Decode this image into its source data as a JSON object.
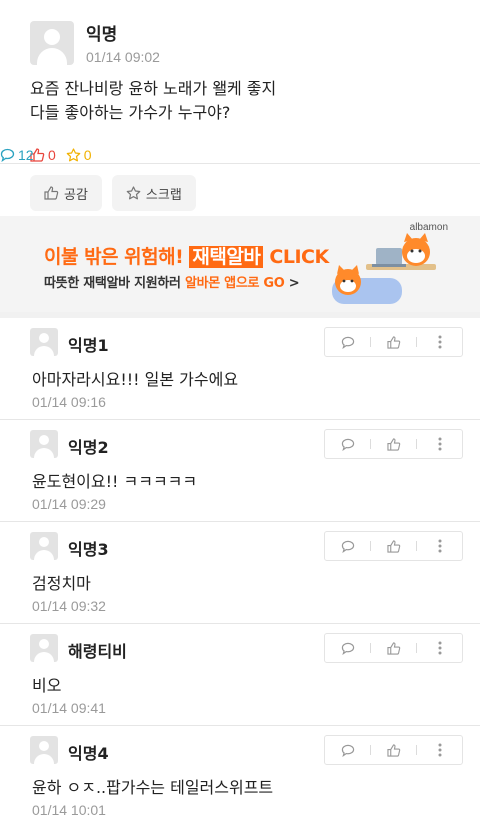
{
  "post": {
    "author": "익명",
    "time": "01/14 09:02",
    "body_line1": "요즘 잔나비랑 윤하 노래가 왤케 좋지",
    "body_line2": "다들 좋아하는 가수가 누구야?",
    "like_count": "0",
    "comment_count": "12",
    "scrap_count": "0",
    "like_button_label": "공감",
    "scrap_button_label": "스크랩"
  },
  "ad": {
    "brand": "albamon",
    "line1_a": "이불 밖은 위험해! ",
    "line1_b": "재택알바",
    "line1_c": " CLICK",
    "line2_a": "따뜻한 재택알바 지원하러 ",
    "line2_b": "알바몬 앱으로 GO",
    "line2_c": " >"
  },
  "comments": [
    {
      "author": "익명1",
      "text": "아마자라시요!!! 일본 가수에요",
      "time": "01/14 09:16"
    },
    {
      "author": "익명2",
      "text": "윤도현이요!! ㅋㅋㅋㅋㅋ",
      "time": "01/14 09:29"
    },
    {
      "author": "익명3",
      "text": "검정치마",
      "time": "01/14 09:32"
    },
    {
      "author": "해령티비",
      "text": "비오",
      "time": "01/14 09:41"
    },
    {
      "author": "익명4",
      "text": "윤하 ㅇㅈ..팝가수는 테일러스위프트",
      "time": "01/14 10:01"
    }
  ],
  "colors": {
    "like": "#e8453c",
    "comment": "#2aa2c0",
    "scrap": "#f1b100",
    "ad_accent": "#ff6a13"
  }
}
